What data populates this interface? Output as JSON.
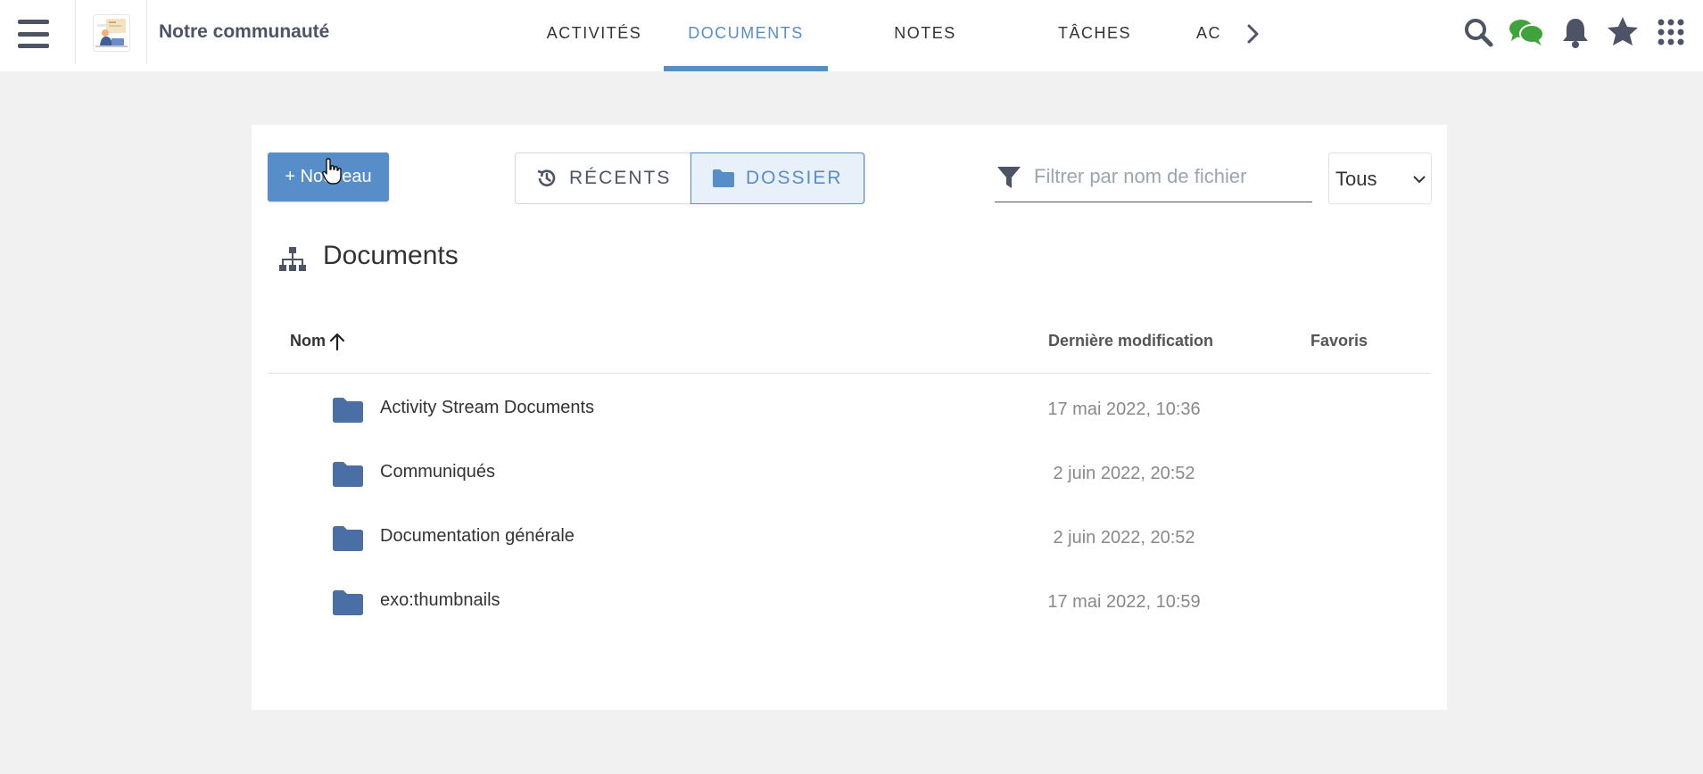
{
  "header": {
    "space_name": "Notre communauté",
    "tabs": [
      {
        "label": "ACTIVITÉS",
        "active": false
      },
      {
        "label": "DOCUMENTS",
        "active": true
      },
      {
        "label": "NOTES",
        "active": false
      },
      {
        "label": "TÂCHES",
        "active": false
      },
      {
        "label": "AC",
        "active": false
      }
    ],
    "icons": [
      "menu-icon",
      "search-icon",
      "chat-icon",
      "bell-icon",
      "star-icon",
      "apps-grid-icon",
      "chevron-right-icon"
    ]
  },
  "toolbar": {
    "new_label": "+ Nouveau",
    "recent_label": "RÉCENTS",
    "folder_label": "DOSSIER",
    "filter_placeholder": "Filtrer par nom de fichier",
    "filter_value": "",
    "type_select": "Tous"
  },
  "folder": {
    "title": "Documents"
  },
  "table": {
    "columns": {
      "name": "Nom",
      "modified": "Dernière modification",
      "favorites": "Favoris"
    },
    "rows": [
      {
        "name": "Activity Stream Documents",
        "modified": "17 mai 2022, 10:36"
      },
      {
        "name": "Communiqués",
        "modified": "2 juin 2022, 20:52"
      },
      {
        "name": "Documentation générale",
        "modified": "2 juin 2022, 20:52"
      },
      {
        "name": "exo:thumbnails",
        "modified": "17 mai 2022, 10:59"
      }
    ]
  },
  "colors": {
    "accent": "#578dc9",
    "icon_dark": "#4d5466",
    "folder_icon": "#4a6fa5",
    "chat_green": "#3fa33b"
  }
}
